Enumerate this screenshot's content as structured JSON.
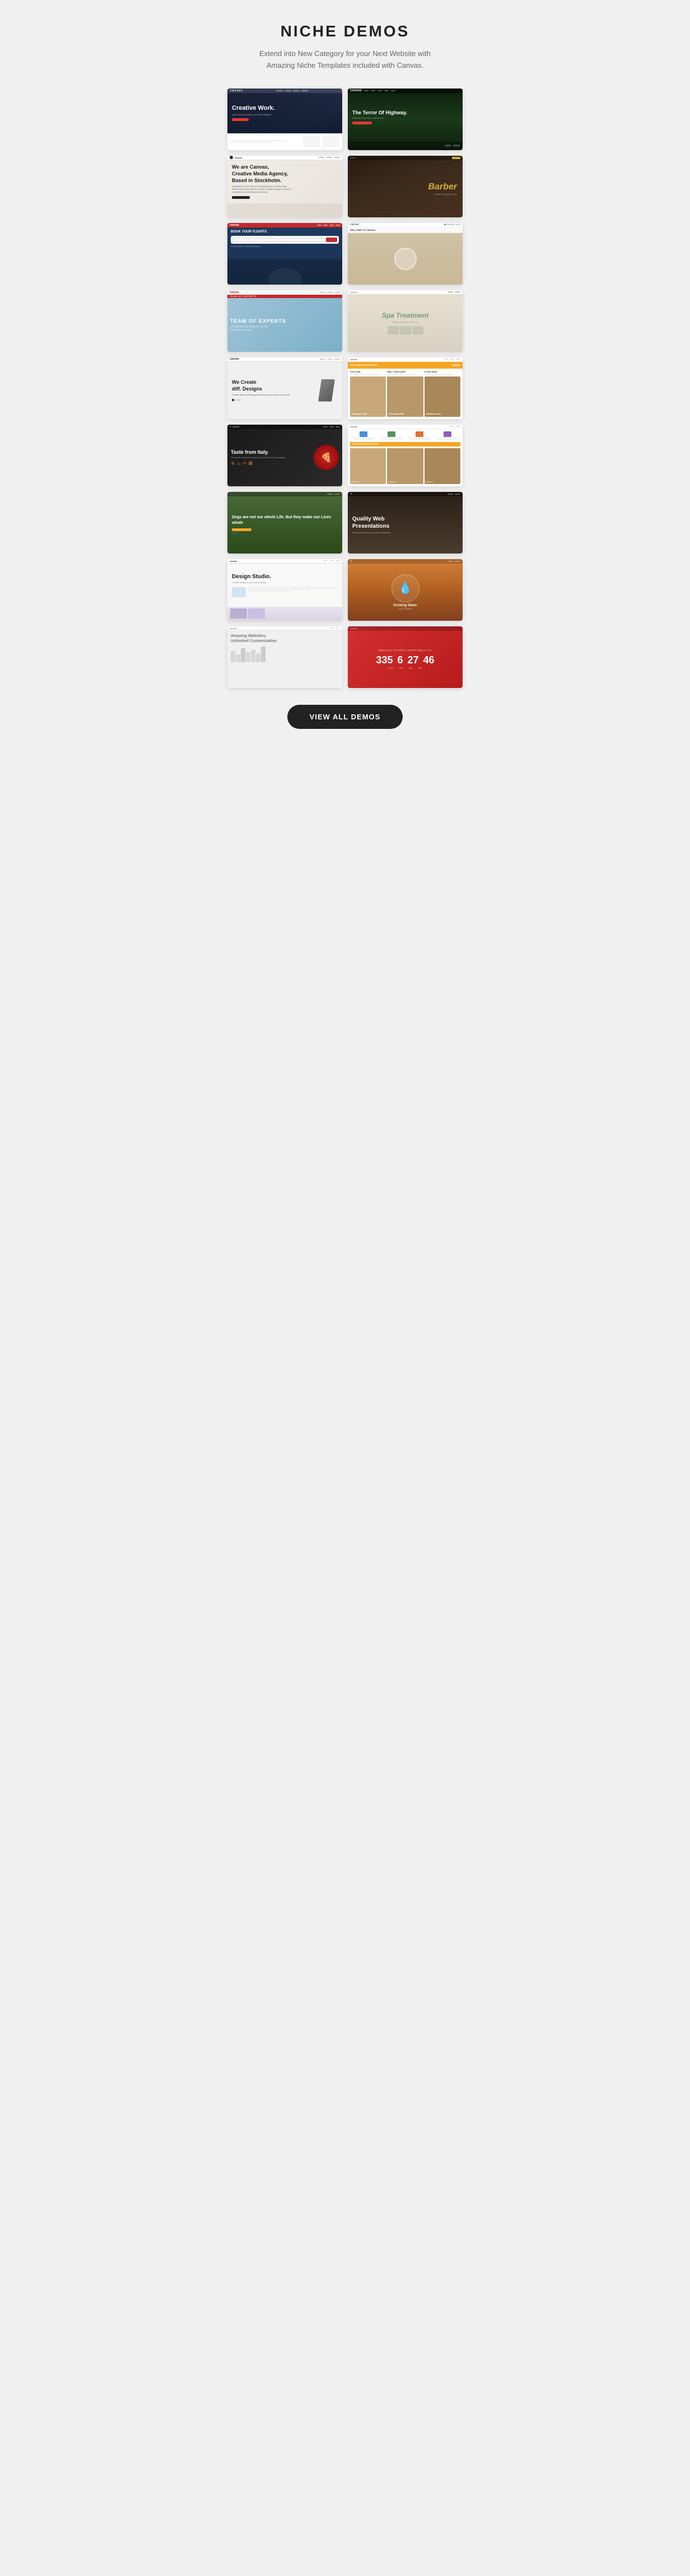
{
  "page": {
    "title": "NICHE DEMOS",
    "subtitle": "Extend into New Category for your Next Website with Amazing Niche Templates included with Canvas.",
    "view_all_button": "VIEW ALL DEMOS"
  },
  "demos": [
    {
      "id": 1,
      "title": "Creative Work.",
      "subtitle": "Take Your Business to the New Heights",
      "type": "corporate",
      "theme": "dark"
    },
    {
      "id": 2,
      "title": "The Terror Of Highway.",
      "type": "automotive",
      "theme": "dark-green"
    },
    {
      "id": 3,
      "title": "We are Canvas, Creative Media Agency, Based in Stockholm.",
      "type": "agency",
      "theme": "light"
    },
    {
      "id": 4,
      "title": "Barber",
      "type": "barber",
      "theme": "dark-gold"
    },
    {
      "id": 5,
      "title": "BOOK YOUR FLIGHTS",
      "type": "travel",
      "theme": "airline"
    },
    {
      "id": 6,
      "title": "WELCOME TO CANVAS",
      "type": "restaurant",
      "theme": "warm"
    },
    {
      "id": 7,
      "title": "TEAM OF EXPERTS",
      "subtitle": "Our Specialist Specialists are devoted to the Best Treatment",
      "type": "medical",
      "theme": "medical-blue"
    },
    {
      "id": 8,
      "title": "Spa Treatment",
      "type": "spa",
      "theme": "natural"
    },
    {
      "id": 9,
      "title": "We Create diff. Designs",
      "type": "design",
      "theme": "light-tech"
    },
    {
      "id": 10,
      "title": "FEATURED PROPERTIES",
      "subtitle": "3 Bedroom Villa",
      "type": "real-estate",
      "theme": "property"
    },
    {
      "id": 11,
      "title": "Taste from Italy.",
      "subtitle": "Why Needs a Boyfriend if there Pizza and Wi-Fi both available.",
      "type": "food",
      "theme": "dark-food"
    },
    {
      "id": 12,
      "title": "FEATURED PROPERTIES",
      "type": "hotel",
      "theme": "property-2"
    },
    {
      "id": 13,
      "title": "Dogs are not our whole Life. But they make our Lives whole",
      "type": "pets",
      "theme": "outdoor"
    },
    {
      "id": 14,
      "title": "Quality Web Presentations",
      "type": "portfolio",
      "theme": "dark-coffee"
    },
    {
      "id": 15,
      "title": "Design Studio.",
      "type": "studio",
      "theme": "bright"
    },
    {
      "id": 16,
      "title": "Drinking Water",
      "type": "nature",
      "theme": "sunset"
    },
    {
      "id": 17,
      "title": "Amazing Websites, Unlimited Customization",
      "type": "tech",
      "theme": "minimal"
    },
    {
      "id": 18,
      "title": "FABULOUS OFFERS & GREAT DEALS TILL",
      "timer": {
        "days": "335",
        "hours": "6",
        "minutes": "27",
        "seconds": "46"
      },
      "type": "deals",
      "theme": "red"
    }
  ]
}
